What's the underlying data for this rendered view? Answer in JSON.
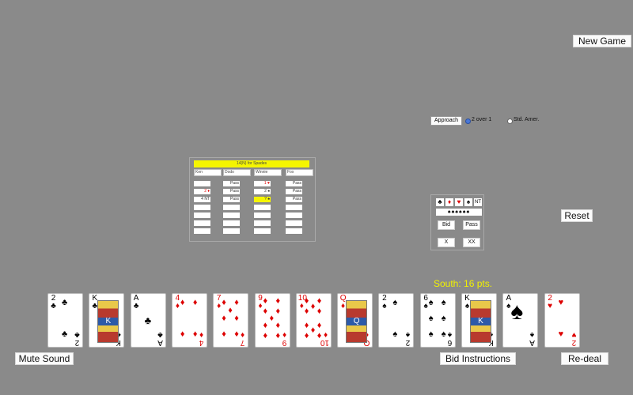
{
  "buttons": {
    "new_game": "New Game",
    "reset": "Reset",
    "mute_sound": "Mute Sound",
    "bid_instructions": "Bid Instructions",
    "redeal": "Re-deal"
  },
  "approach": {
    "button": "Approach",
    "options": [
      {
        "label": "2 over 1",
        "selected": true
      },
      {
        "label": "Std. Amer.",
        "selected": false
      }
    ]
  },
  "auction": {
    "contract": "14(N) for Spades",
    "players": [
      "Ken",
      "Dodo",
      "Winnie",
      "Fox"
    ],
    "rows": [
      [
        "",
        "Pass",
        "1 ♥",
        "Pass"
      ],
      [
        "2 ♦",
        "Pass",
        "2 ♠",
        "Pass"
      ],
      [
        "4 NT",
        "Pass",
        "? ♠",
        "Pass"
      ],
      [
        "",
        "",
        "",
        ""
      ],
      [
        "",
        "",
        "",
        ""
      ],
      [
        "",
        "",
        "",
        ""
      ],
      [
        "",
        "",
        "",
        ""
      ]
    ]
  },
  "bidbox": {
    "suits": [
      "♣",
      "♦",
      "♥",
      "♠",
      "NT"
    ],
    "levels": "♠♠♠♠♠♠",
    "bid": "Bid",
    "pass": "Pass",
    "double": "X",
    "redouble": "XX"
  },
  "score": {
    "text": "South: 16 pts."
  },
  "hand": [
    {
      "rank": "2",
      "suit": "♣",
      "color": "black"
    },
    {
      "rank": "K",
      "suit": "♣",
      "color": "black"
    },
    {
      "rank": "A",
      "suit": "♣",
      "color": "black"
    },
    {
      "rank": "4",
      "suit": "♦",
      "color": "red"
    },
    {
      "rank": "7",
      "suit": "♦",
      "color": "red"
    },
    {
      "rank": "9",
      "suit": "♦",
      "color": "red"
    },
    {
      "rank": "10",
      "suit": "♦",
      "color": "red"
    },
    {
      "rank": "Q",
      "suit": "♦",
      "color": "red"
    },
    {
      "rank": "2",
      "suit": "♠",
      "color": "black"
    },
    {
      "rank": "6",
      "suit": "♠",
      "color": "black"
    },
    {
      "rank": "K",
      "suit": "♠",
      "color": "black"
    },
    {
      "rank": "A",
      "suit": "♠",
      "color": "black"
    },
    {
      "rank": "2",
      "suit": "♥",
      "color": "red"
    }
  ],
  "colors": {
    "background": "#8a8a8a",
    "highlight": "#f5f500",
    "score": "#f2f200",
    "red_suit": "#dd0000"
  }
}
